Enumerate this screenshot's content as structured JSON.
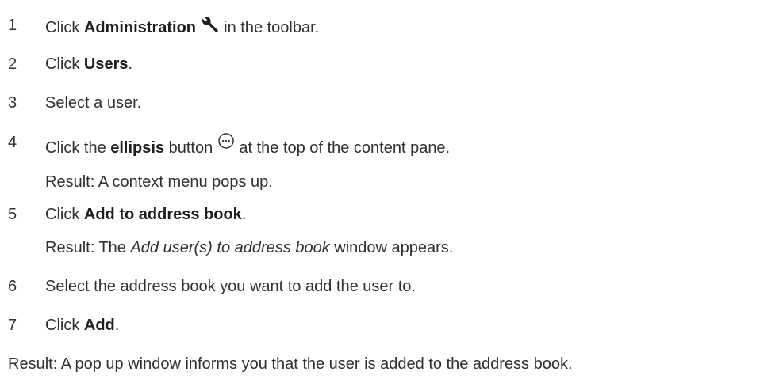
{
  "steps": [
    {
      "number": "1",
      "pre": "Click ",
      "bold": "Administration",
      "icon": "wrench-icon",
      "post": " in the toolbar."
    },
    {
      "number": "2",
      "pre": "Click ",
      "bold": "Users",
      "post": "."
    },
    {
      "number": "3",
      "text": "Select a user."
    },
    {
      "number": "4",
      "pre": "Click the ",
      "bold": "ellipsis",
      "mid": " button",
      "icon": "ellipsis-circle-icon",
      "post": " at the top of the content pane.",
      "result": "Result: A context menu pops up."
    },
    {
      "number": "5",
      "pre": "Click ",
      "bold": "Add to address book",
      "post": ".",
      "result_pre": "Result: The ",
      "result_italic": "Add user(s) to address book",
      "result_post": " window appears."
    },
    {
      "number": "6",
      "text": "Select the address book you want to add the user to."
    },
    {
      "number": "7",
      "pre": "Click ",
      "bold": "Add",
      "post": "."
    }
  ],
  "final_result": "Result: A pop up window informs you that the user is added to the address book."
}
